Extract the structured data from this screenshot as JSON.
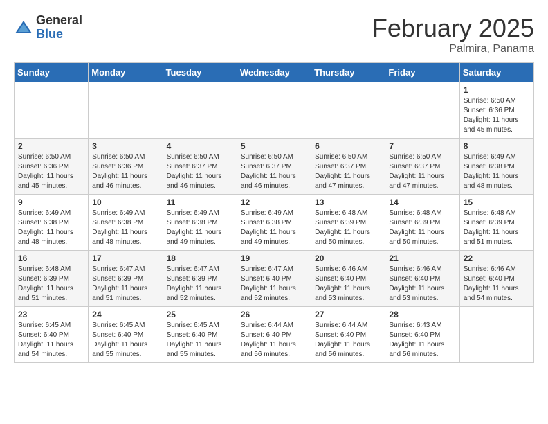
{
  "header": {
    "logo_general": "General",
    "logo_blue": "Blue",
    "month_title": "February 2025",
    "location": "Palmira, Panama"
  },
  "days_of_week": [
    "Sunday",
    "Monday",
    "Tuesday",
    "Wednesday",
    "Thursday",
    "Friday",
    "Saturday"
  ],
  "weeks": [
    [
      {
        "day": "",
        "info": ""
      },
      {
        "day": "",
        "info": ""
      },
      {
        "day": "",
        "info": ""
      },
      {
        "day": "",
        "info": ""
      },
      {
        "day": "",
        "info": ""
      },
      {
        "day": "",
        "info": ""
      },
      {
        "day": "1",
        "info": "Sunrise: 6:50 AM\nSunset: 6:36 PM\nDaylight: 11 hours\nand 45 minutes."
      }
    ],
    [
      {
        "day": "2",
        "info": "Sunrise: 6:50 AM\nSunset: 6:36 PM\nDaylight: 11 hours\nand 45 minutes."
      },
      {
        "day": "3",
        "info": "Sunrise: 6:50 AM\nSunset: 6:36 PM\nDaylight: 11 hours\nand 46 minutes."
      },
      {
        "day": "4",
        "info": "Sunrise: 6:50 AM\nSunset: 6:37 PM\nDaylight: 11 hours\nand 46 minutes."
      },
      {
        "day": "5",
        "info": "Sunrise: 6:50 AM\nSunset: 6:37 PM\nDaylight: 11 hours\nand 46 minutes."
      },
      {
        "day": "6",
        "info": "Sunrise: 6:50 AM\nSunset: 6:37 PM\nDaylight: 11 hours\nand 47 minutes."
      },
      {
        "day": "7",
        "info": "Sunrise: 6:50 AM\nSunset: 6:37 PM\nDaylight: 11 hours\nand 47 minutes."
      },
      {
        "day": "8",
        "info": "Sunrise: 6:49 AM\nSunset: 6:38 PM\nDaylight: 11 hours\nand 48 minutes."
      }
    ],
    [
      {
        "day": "9",
        "info": "Sunrise: 6:49 AM\nSunset: 6:38 PM\nDaylight: 11 hours\nand 48 minutes."
      },
      {
        "day": "10",
        "info": "Sunrise: 6:49 AM\nSunset: 6:38 PM\nDaylight: 11 hours\nand 48 minutes."
      },
      {
        "day": "11",
        "info": "Sunrise: 6:49 AM\nSunset: 6:38 PM\nDaylight: 11 hours\nand 49 minutes."
      },
      {
        "day": "12",
        "info": "Sunrise: 6:49 AM\nSunset: 6:38 PM\nDaylight: 11 hours\nand 49 minutes."
      },
      {
        "day": "13",
        "info": "Sunrise: 6:48 AM\nSunset: 6:39 PM\nDaylight: 11 hours\nand 50 minutes."
      },
      {
        "day": "14",
        "info": "Sunrise: 6:48 AM\nSunset: 6:39 PM\nDaylight: 11 hours\nand 50 minutes."
      },
      {
        "day": "15",
        "info": "Sunrise: 6:48 AM\nSunset: 6:39 PM\nDaylight: 11 hours\nand 51 minutes."
      }
    ],
    [
      {
        "day": "16",
        "info": "Sunrise: 6:48 AM\nSunset: 6:39 PM\nDaylight: 11 hours\nand 51 minutes."
      },
      {
        "day": "17",
        "info": "Sunrise: 6:47 AM\nSunset: 6:39 PM\nDaylight: 11 hours\nand 51 minutes."
      },
      {
        "day": "18",
        "info": "Sunrise: 6:47 AM\nSunset: 6:39 PM\nDaylight: 11 hours\nand 52 minutes."
      },
      {
        "day": "19",
        "info": "Sunrise: 6:47 AM\nSunset: 6:40 PM\nDaylight: 11 hours\nand 52 minutes."
      },
      {
        "day": "20",
        "info": "Sunrise: 6:46 AM\nSunset: 6:40 PM\nDaylight: 11 hours\nand 53 minutes."
      },
      {
        "day": "21",
        "info": "Sunrise: 6:46 AM\nSunset: 6:40 PM\nDaylight: 11 hours\nand 53 minutes."
      },
      {
        "day": "22",
        "info": "Sunrise: 6:46 AM\nSunset: 6:40 PM\nDaylight: 11 hours\nand 54 minutes."
      }
    ],
    [
      {
        "day": "23",
        "info": "Sunrise: 6:45 AM\nSunset: 6:40 PM\nDaylight: 11 hours\nand 54 minutes."
      },
      {
        "day": "24",
        "info": "Sunrise: 6:45 AM\nSunset: 6:40 PM\nDaylight: 11 hours\nand 55 minutes."
      },
      {
        "day": "25",
        "info": "Sunrise: 6:45 AM\nSunset: 6:40 PM\nDaylight: 11 hours\nand 55 minutes."
      },
      {
        "day": "26",
        "info": "Sunrise: 6:44 AM\nSunset: 6:40 PM\nDaylight: 11 hours\nand 56 minutes."
      },
      {
        "day": "27",
        "info": "Sunrise: 6:44 AM\nSunset: 6:40 PM\nDaylight: 11 hours\nand 56 minutes."
      },
      {
        "day": "28",
        "info": "Sunrise: 6:43 AM\nSunset: 6:40 PM\nDaylight: 11 hours\nand 56 minutes."
      },
      {
        "day": "",
        "info": ""
      }
    ]
  ]
}
